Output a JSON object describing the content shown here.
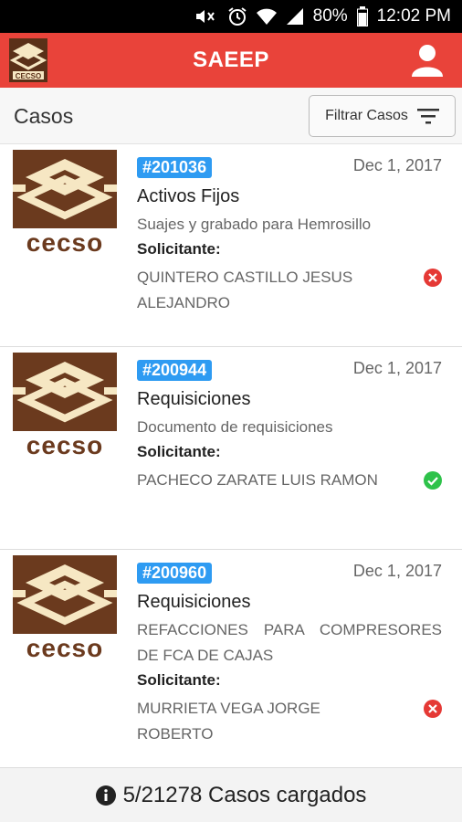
{
  "status_bar": {
    "battery": "80%",
    "time": "12:02 PM"
  },
  "app_bar": {
    "logo_text": "CECSO",
    "title": "SAEEP"
  },
  "sub_header": {
    "title": "Casos",
    "filter_label": "Filtrar Casos"
  },
  "cases": [
    {
      "logo_text": "cecso",
      "id": "#201036",
      "date": "Dec 1, 2017",
      "type": "Activos Fijos",
      "description": "Suajes y grabado para Hemrosillo",
      "solicitante_label": "Solicitante:",
      "solicitante": "QUINTERO CASTILLO JESUS ALEJANDRO",
      "status": "rejected"
    },
    {
      "logo_text": "cecso",
      "id": "#200944",
      "date": "Dec 1, 2017",
      "type": "Requisiciones",
      "description": "Documento de requisiciones",
      "solicitante_label": "Solicitante:",
      "solicitante": "PACHECO ZARATE LUIS RAMON",
      "status": "approved"
    },
    {
      "logo_text": "cecso",
      "id": "#200960",
      "date": "Dec 1, 2017",
      "type": "Requisiciones",
      "description": "REFACCIONES PARA COMPRESORES DE FCA DE CAJAS",
      "solicitante_label": "Solicitante:",
      "solicitante": "MURRIETA VEGA JORGE ROBERTO",
      "status": "rejected"
    }
  ],
  "footer": {
    "text": "5/21278 Casos cargados"
  },
  "colors": {
    "app_bar": "#e9433a",
    "badge": "#2e9bf2",
    "logo_brown": "#6b3a1e",
    "logo_cream": "#f6e7c3",
    "rejected": "#e53935",
    "approved": "#2ec24a"
  }
}
